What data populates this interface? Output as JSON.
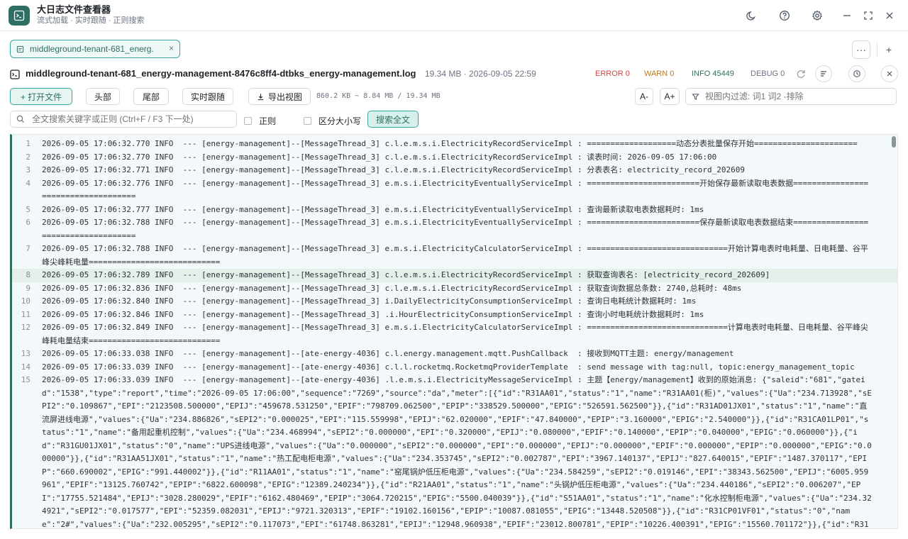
{
  "app": {
    "title": "大日志文件查看器",
    "subtitle": "流式加载 · 实时跟随 · 正则搜索"
  },
  "tab": {
    "label": "middleground-tenant-681_energ...",
    "close": "×"
  },
  "tabbar": {
    "more": "···",
    "add": "+"
  },
  "file": {
    "name": "middleground-tenant-681_energy-management-8476c8ff4-dtbks_energy-management.log",
    "meta": "19.34 MB · 2026-09-05 22:59",
    "levels": {
      "error": "ERROR 0",
      "warn": "WARN 0",
      "info": "INFO 45449",
      "debug": "DEBUG 0"
    }
  },
  "toolbar": {
    "open": "+ 打开文件",
    "head": "头部",
    "tail": "尾部",
    "follow": "实时跟随",
    "export": "导出视图",
    "range": "860.2 KB ~ 8.84 MB / 19.34 MB",
    "font_down": "A-",
    "font_up": "A+",
    "filter_placeholder": "视图内过滤: 词1 词2 -排除"
  },
  "search": {
    "placeholder": "全文搜索关键字或正则 (Ctrl+F / F3 下一处)",
    "regex": "正则",
    "case": "区分大小写",
    "button": "搜索全文"
  },
  "colors": {
    "accent": "#2f6f63",
    "error": "#d14343",
    "warn": "#b7791f",
    "info": "#2f6f63",
    "debug": "#6b7280"
  },
  "lines": [
    {
      "n": "1",
      "t": "2026-09-05 17:06:32.770 INFO  --- [energy-management]--[MessageThread_3] c.l.e.m.s.i.ElectricityRecordServiceImpl : ===================动态分表批量保存开始======================"
    },
    {
      "n": "2",
      "t": "2026-09-05 17:06:32.770 INFO  --- [energy-management]--[MessageThread_3] c.l.e.m.s.i.ElectricityRecordServiceImpl : 读表时间: 2026-09-05 17:06:00"
    },
    {
      "n": "3",
      "t": "2026-09-05 17:06:32.771 INFO  --- [energy-management]--[MessageThread_3] c.l.e.m.s.i.ElectricityRecordServiceImpl : 分表表名: electricity_record_202609"
    },
    {
      "n": "4",
      "t": "2026-09-05 17:06:32.776 INFO  --- [energy-management]--[MessageThread_3] e.m.s.i.ElectricityEventuallyServiceImpl : ========================开始保存最新读取电表数据===================================="
    },
    {
      "n": "5",
      "t": "2026-09-05 17:06:32.777 INFO  --- [energy-management]--[MessageThread_3] e.m.s.i.ElectricityEventuallyServiceImpl : 查询最新读取电表数据耗时: 1ms"
    },
    {
      "n": "6",
      "t": "2026-09-05 17:06:32.788 INFO  --- [energy-management]--[MessageThread_3] e.m.s.i.ElectricityEventuallyServiceImpl : ========================保存最新读取电表数据结束===================================="
    },
    {
      "n": "7",
      "t": "2026-09-05 17:06:32.788 INFO  --- [energy-management]--[MessageThread_3] e.m.s.i.ElectricityCalculatorServiceImpl : ==============================开始计算电表时电耗量、日电耗量、谷平峰尖峰耗电量============================"
    },
    {
      "n": "8",
      "t": "2026-09-05 17:06:32.789 INFO  --- [energy-management]--[MessageThread_3] c.l.e.m.s.i.ElectricityRecordServiceImpl : 获取查询表名: [electricity_record_202609]",
      "hl": true
    },
    {
      "n": "9",
      "t": "2026-09-05 17:06:32.836 INFO  --- [energy-management]--[MessageThread_3] c.l.e.m.s.i.ElectricityRecordServiceImpl : 获取查询数据总条数: 2740,总耗时: 48ms"
    },
    {
      "n": "10",
      "t": "2026-09-05 17:06:32.840 INFO  --- [energy-management]--[MessageThread_3] i.DailyElectricityConsumptionServiceImpl : 查询日电耗统计数据耗时: 1ms"
    },
    {
      "n": "11",
      "t": "2026-09-05 17:06:32.846 INFO  --- [energy-management]--[MessageThread_3] .i.HourElectricityConsumptionServiceImpl : 查询小时电耗统计数据耗时: 1ms"
    },
    {
      "n": "12",
      "t": "2026-09-05 17:06:32.849 INFO  --- [energy-management]--[MessageThread_3] e.m.s.i.ElectricityCalculatorServiceImpl : ==============================计算电表时电耗量、日电耗量、谷平峰尖峰耗电量结束============================"
    },
    {
      "n": "13",
      "t": "2026-09-05 17:06:33.038 INFO  --- [energy-management]--[ate-energy-4036] c.l.energy.management.mqtt.PushCallback  : 接收到MQTT主题: energy/management"
    },
    {
      "n": "14",
      "t": "2026-09-05 17:06:33.039 INFO  --- [energy-management]--[ate-energy-4036] c.l.l.rocketmq.RocketmqProviderTemplate  : send message with tag:null, topic:energy_management_topic"
    },
    {
      "n": "15",
      "t": "2026-09-05 17:06:33.039 INFO  --- [energy-management]--[ate-energy-4036] .l.e.m.s.i.ElectricityMessageServiceImpl : 主题【energy/management】收到的原始消息: {\"saleid\":\"681\",\"gateid\":\"1538\",\"type\":\"report\",\"time\":\"2026-09-05 17:06:00\",\"sequence\":\"7269\",\"source\":\"da\",\"meter\":[{\"id\":\"R31AA01\",\"status\":\"1\",\"name\":\"R31AA01(柜)\",\"values\":{\"Ua\":\"234.713928\",\"sEPI2\":\"0.109867\",\"EPI\":\"2123508.500000\",\"EPIJ\":\"459678.531250\",\"EPIF\":\"798709.062500\",\"EPIP\":\"338529.500000\",\"EPIG\":\"526591.562500\"}},{\"id\":\"R31AD01JX01\",\"status\":\"1\",\"name\":\"直流屏进线电源\",\"values\":{\"Ua\":\"234.886826\",\"sEPI2\":\"0.000025\",\"EPI\":\"115.559998\",\"EPIJ\":\"62.020000\",\"EPIF\":\"47.840000\",\"EPIP\":\"3.160000\",\"EPIG\":\"2.540000\"}},{\"id\":\"R31CA01LP01\",\"status\":\"1\",\"name\":\"备用起重机控制\",\"values\":{\"Ua\":\"234.468994\",\"sEPI2\":\"0.000000\",\"EPI\":\"0.320000\",\"EPIJ\":\"0.080000\",\"EPIF\":\"0.140000\",\"EPIP\":\"0.040000\",\"EPIG\":\"0.060000\"}},{\"id\":\"R31GU01JX01\",\"status\":\"0\",\"name\":\"UPS进线电源\",\"values\":{\"Ua\":\"0.000000\",\"sEPI2\":\"0.000000\",\"EPI\":\"0.000000\",\"EPIJ\":\"0.000000\",\"EPIF\":\"0.000000\",\"EPIP\":\"0.000000\",\"EPIG\":\"0.000000\"}},{\"id\":\"R31AA51JX01\",\"status\":\"1\",\"name\":\"热工配电柜电源\",\"values\":{\"Ua\":\"234.353745\",\"sEPI2\":\"0.002787\",\"EPI\":\"3967.140137\",\"EPIJ\":\"827.640015\",\"EPIF\":\"1487.370117\",\"EPIP\":\"660.690002\",\"EPIG\":\"991.440002\"}},{\"id\":\"R11AA01\",\"status\":\"1\",\"name\":\"窑尾锅炉低压柜电源\",\"values\":{\"Ua\":\"234.584259\",\"sEPI2\":\"0.019146\",\"EPI\":\"38343.562500\",\"EPIJ\":\"6005.959961\",\"EPIF\":\"13125.760742\",\"EPIP\":\"6822.600098\",\"EPIG\":\"12389.240234\"}},{\"id\":\"R21AA01\",\"status\":\"1\",\"name\":\"头锅炉低压柜电源\",\"values\":{\"Ua\":\"234.440186\",\"sEPI2\":\"0.006207\",\"EPI\":\"17755.521484\",\"EPIJ\":\"3028.280029\",\"EPIF\":\"6162.480469\",\"EPIP\":\"3064.720215\",\"EPIG\":\"5500.040039\"}},{\"id\":\"S51AA01\",\"status\":\"1\",\"name\":\"化水控制柜电源\",\"values\":{\"Ua\":\"234.324921\",\"sEPI2\":\"0.017577\",\"EPI\":\"52359.082031\",\"EPIJ\":\"9721.320313\",\"EPIF\":\"19102.160156\",\"EPIP\":\"10087.081055\",\"EPIG\":\"13448.520508\"}},{\"id\":\"R31CP01VF01\",\"status\":\"0\",\"name\":\"2#\",\"values\":{\"Ua\":\"232.005295\",\"sEPI2\":\"0.117073\",\"EPI\":\"61748.863281\",\"EPIJ\":\"12948.960938\",\"EPIF\":\"23012.800781\",\"EPIP\":\"10226.400391\",\"EPIG\":\"15560.701172\"}},{\"id\":\"R31C"
    }
  ]
}
